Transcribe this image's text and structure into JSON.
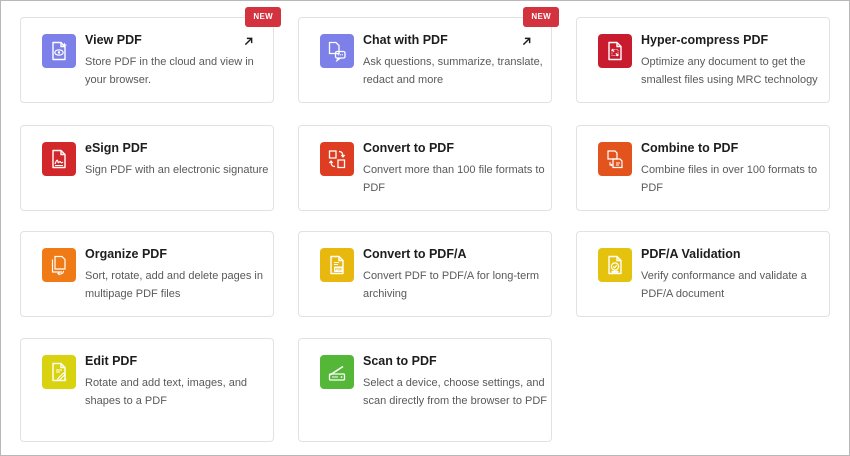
{
  "badge_label": "NEW",
  "cards": [
    {
      "title": "View PDF",
      "desc": "Store PDF in the cloud and view in your browser.",
      "icon": "view-pdf-icon",
      "color": "#7c80e8"
    },
    {
      "title": "Chat with PDF",
      "desc": "Ask questions, summarize, translate, redact and more",
      "icon": "chat-pdf-icon",
      "color": "#7c80e8"
    },
    {
      "title": "Hyper-compress PDF",
      "desc": "Optimize any document to get the smallest files using MRC technology",
      "icon": "compress-pdf-icon",
      "color": "#c81c2e"
    },
    {
      "title": "eSign PDF",
      "desc": "Sign PDF with an electronic signature",
      "icon": "esign-pdf-icon",
      "color": "#d3282b"
    },
    {
      "title": "Convert to PDF",
      "desc": "Convert more than 100 file formats to PDF",
      "icon": "convert-pdf-icon",
      "color": "#df3d22"
    },
    {
      "title": "Combine to PDF",
      "desc": "Combine files in over 100 formats to PDF",
      "icon": "combine-pdf-icon",
      "color": "#e3531e"
    },
    {
      "title": "Organize PDF",
      "desc": "Sort, rotate, add and delete pages in multipage PDF files",
      "icon": "organize-pdf-icon",
      "color": "#ef7a16"
    },
    {
      "title": "Convert to PDF/A",
      "desc": "Convert PDF to PDF/A for long-term archiving",
      "icon": "convert-pdfa-icon",
      "color": "#e9b80f"
    },
    {
      "title": "PDF/A Validation",
      "desc": "Verify conformance and validate a PDF/A document",
      "icon": "pdfa-validation-icon",
      "color": "#e5c20e"
    },
    {
      "title": "Edit PDF",
      "desc": "Rotate and add text, images, and shapes to a PDF",
      "icon": "edit-pdf-icon",
      "color": "#d9d20f"
    },
    {
      "title": "Scan to PDF",
      "desc": "Select a device, choose settings, and scan directly from the browser to PDF",
      "icon": "scan-pdf-icon",
      "color": "#55b738"
    }
  ]
}
